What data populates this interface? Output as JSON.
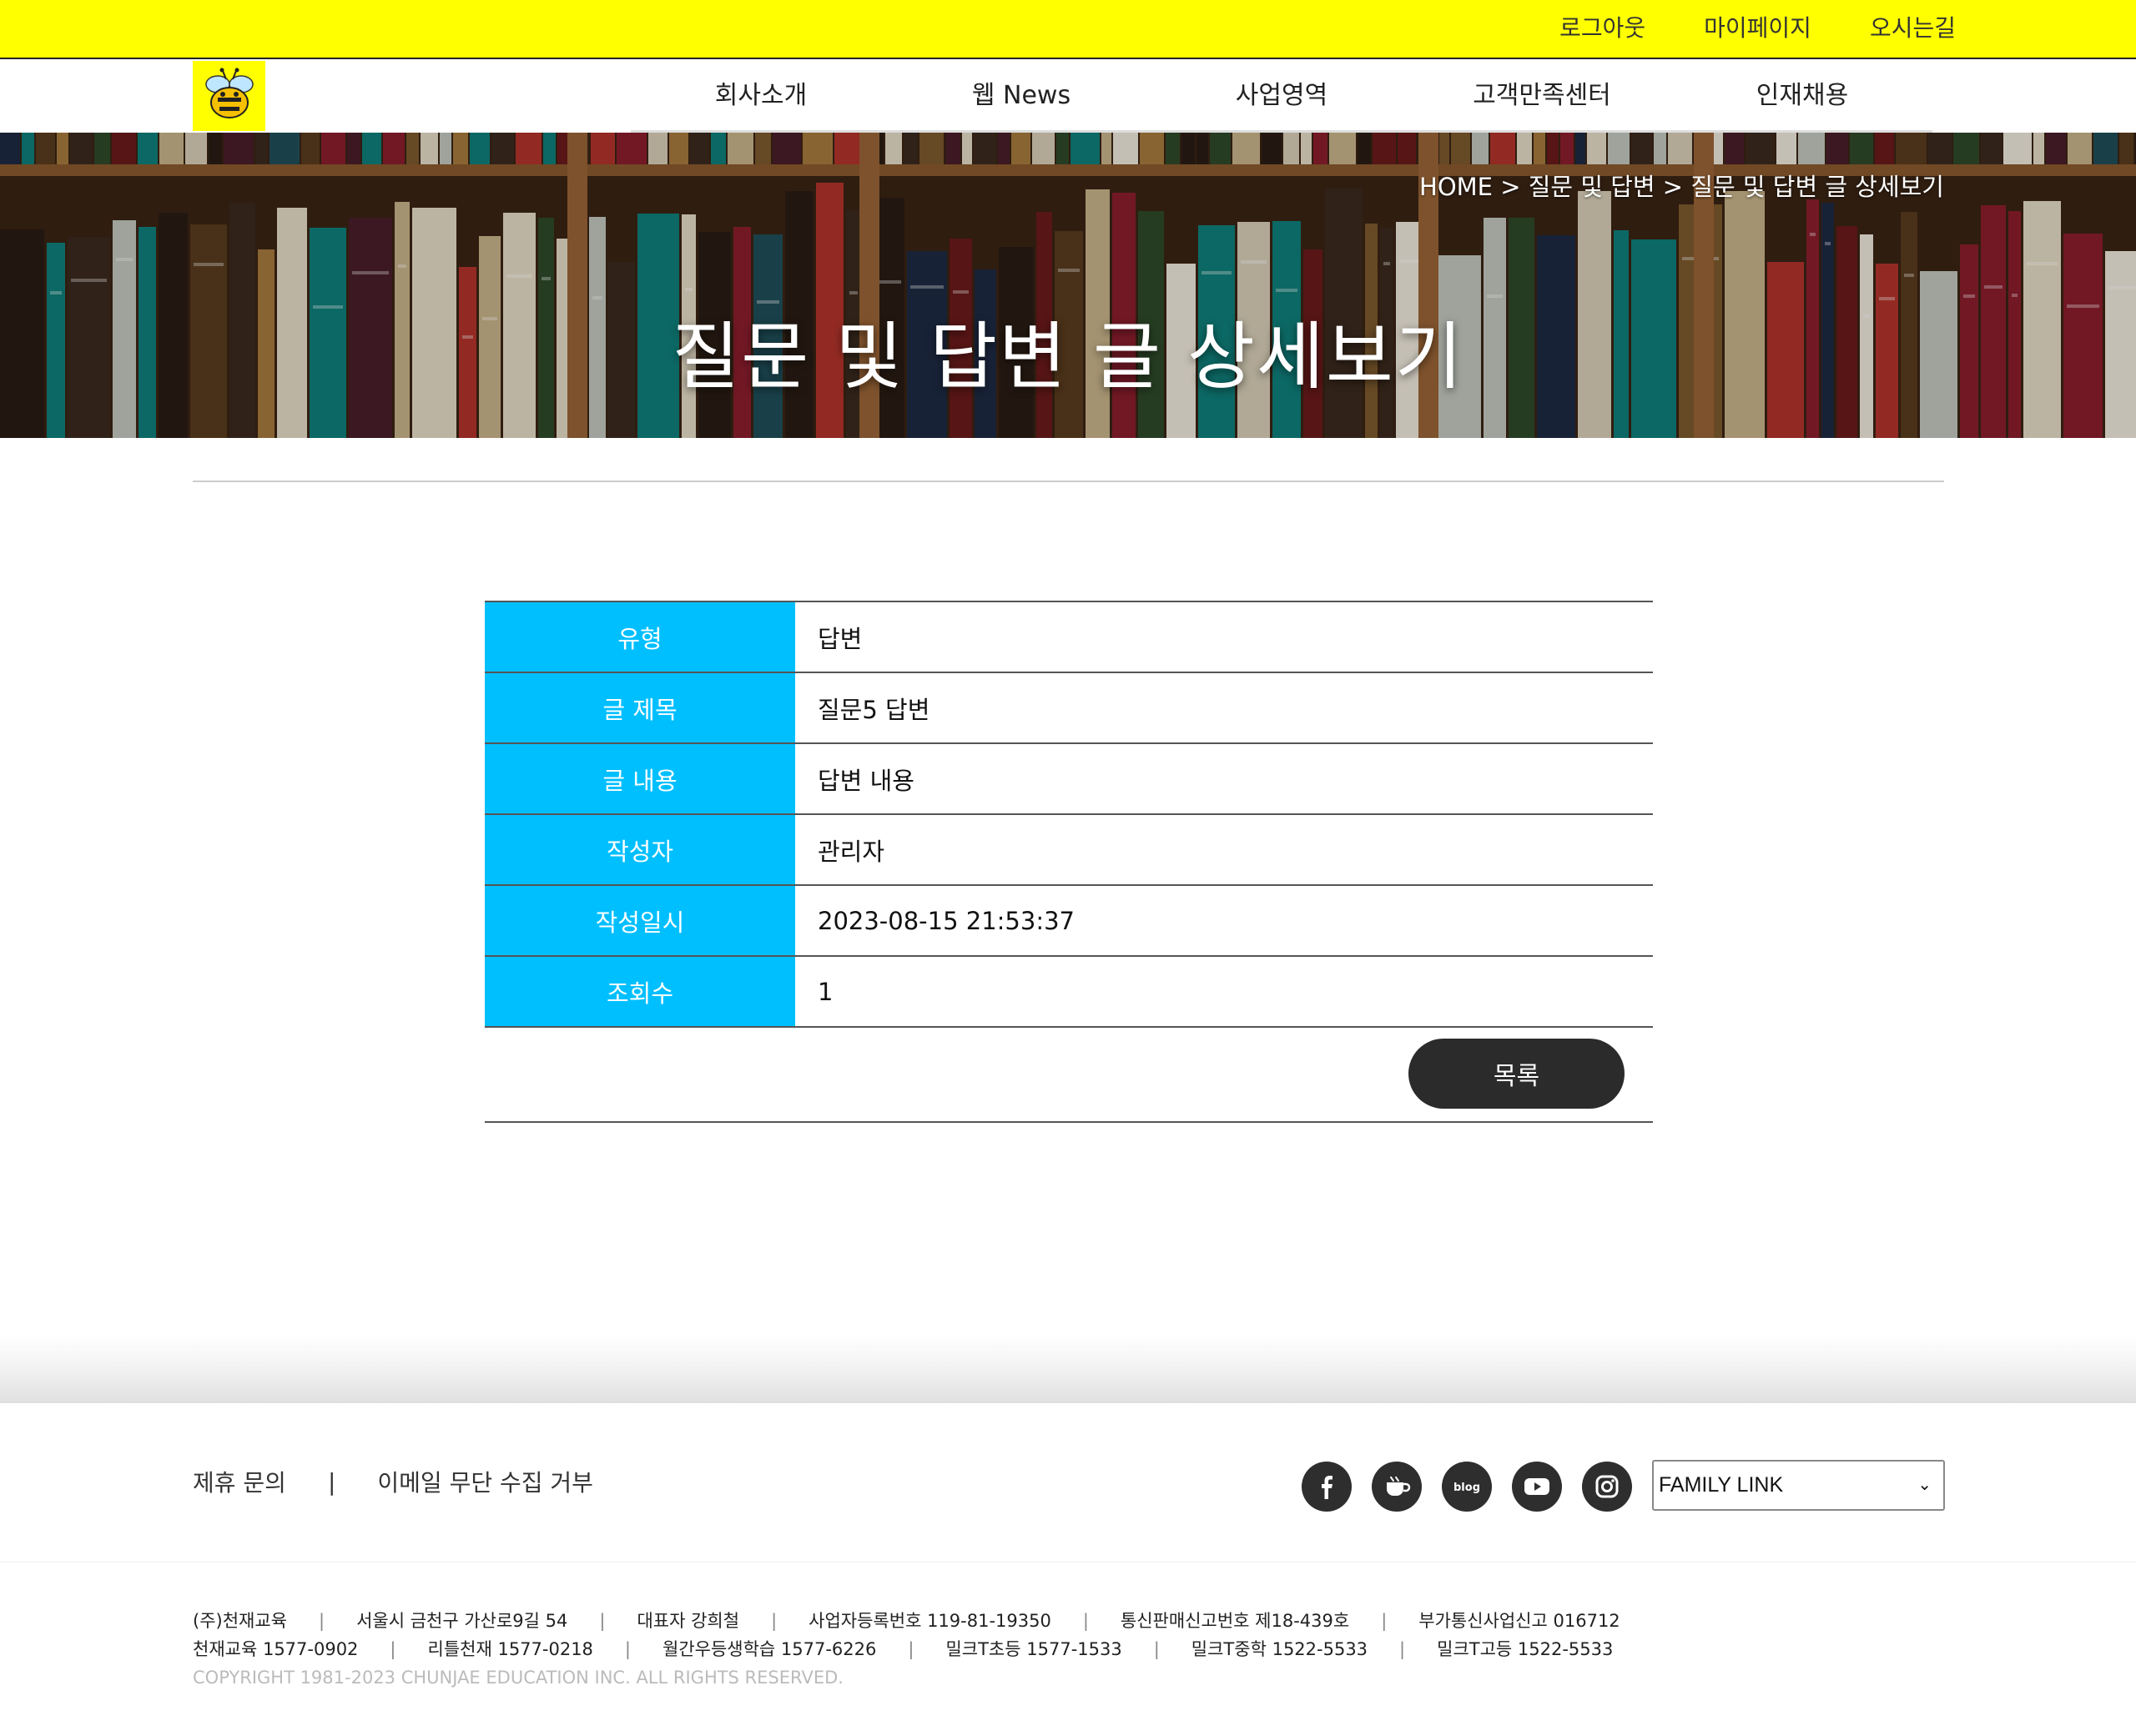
{
  "top_links": [
    "로그아웃",
    "마이페이지",
    "오시는길"
  ],
  "menu": [
    "회사소개",
    "웹 News",
    "사업영역",
    "고객만족센터",
    "인재채용"
  ],
  "breadcrumb": "HOME > 질문 및 답변 > 질문 및 답변 글 상세보기",
  "hero_title": "질문 및 답변 글 상세보기",
  "detail": {
    "type_label": "유형",
    "type_value": "답변",
    "title_label": "글 제목",
    "title_value": "질문5 답변",
    "content_label": "글 내용",
    "content_value": "답변 내용",
    "author_label": "작성자",
    "author_value": "관리자",
    "date_label": "작성일시",
    "date_value": "2023-08-15 21:53:37",
    "views_label": "조회수",
    "views_value": "1"
  },
  "list_button": "목록",
  "footer": {
    "link1": "제휴 문의",
    "separator": "|",
    "link2": "이메일 무단 수집 거부",
    "family_link": "FAMILY LINK",
    "social_icons": [
      "facebook-icon",
      "cafe-icon",
      "blog-icon",
      "youtube-icon",
      "instagram-icon"
    ],
    "blog_text": "blog",
    "info_line1": [
      "(주)천재교육",
      "서울시 금천구 가산로9길 54",
      "대표자 강희철",
      "사업자등록번호 119-81-19350",
      "통신판매신고번호 제18-439호",
      "부가통신사업신고 016712"
    ],
    "info_line2": [
      "천재교육 1577-0902",
      "리틀천재 1577-0218",
      "월간우등생학습 1577-6226",
      "밀크T초등 1577-1533",
      "밀크T중학 1522-5533",
      "밀크T고등 1522-5533"
    ],
    "copyright": "COPYRIGHT 1981-2023 CHUNJAE EDUCATION INC. ALL RIGHTS RESERVED."
  },
  "colors": {
    "topbar": "#ffff00",
    "table_header": "#00bfff",
    "button": "#2b2b2b"
  }
}
